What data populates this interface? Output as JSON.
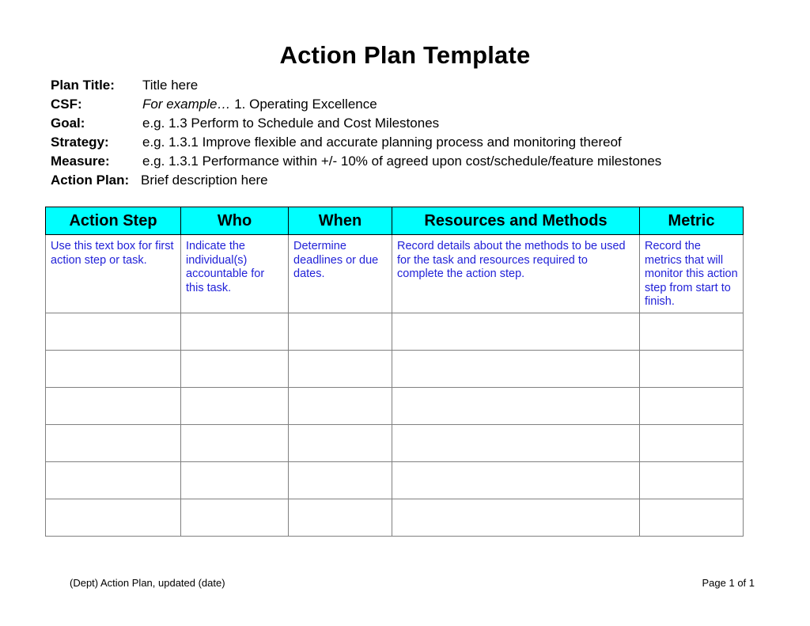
{
  "document": {
    "title": "Action Plan Template"
  },
  "meta": {
    "rows": [
      {
        "label": "Plan Title:",
        "value": "Title here",
        "italic_prefix": ""
      },
      {
        "label": "CSF:",
        "value": "1. Operating Excellence",
        "italic_prefix": "For example… "
      },
      {
        "label": "Goal:",
        "value": "e.g.  1.3  Perform to Schedule and Cost Milestones",
        "italic_prefix": ""
      },
      {
        "label": "Strategy:",
        "value": "e.g.  1.3.1  Improve flexible and accurate planning process and monitoring thereof",
        "italic_prefix": ""
      },
      {
        "label": "Measure:",
        "value": "e.g.  1.3.1  Performance within +/- 10% of agreed upon cost/schedule/feature milestones",
        "italic_prefix": ""
      },
      {
        "label": "Action Plan:",
        "value": "Brief description here",
        "italic_prefix": ""
      }
    ]
  },
  "table": {
    "headers": [
      "Action Step",
      "Who",
      "When",
      "Resources and Methods",
      "Metric"
    ],
    "header_background": "#00FFFF",
    "cell_text_color": "#2222D8",
    "border_color": "#808080",
    "rows": [
      {
        "action_step": "Use this text box for first action step or task.",
        "who": "Indicate the individual(s) accountable for this task.",
        "when": "Determine deadlines or due dates.",
        "resources": "Record details about the methods to be used for the task and resources required to complete the action step.",
        "metric": "Record the metrics that will monitor this action step from start to finish."
      },
      {
        "action_step": "",
        "who": "",
        "when": "",
        "resources": "",
        "metric": ""
      },
      {
        "action_step": "",
        "who": "",
        "when": "",
        "resources": "",
        "metric": ""
      },
      {
        "action_step": "",
        "who": "",
        "when": "",
        "resources": "",
        "metric": ""
      },
      {
        "action_step": "",
        "who": "",
        "when": "",
        "resources": "",
        "metric": ""
      },
      {
        "action_step": "",
        "who": "",
        "when": "",
        "resources": "",
        "metric": ""
      },
      {
        "action_step": "",
        "who": "",
        "when": "",
        "resources": "",
        "metric": ""
      }
    ]
  },
  "footer": {
    "left": "(Dept) Action Plan, updated (date)",
    "right": "Page 1 of 1"
  }
}
